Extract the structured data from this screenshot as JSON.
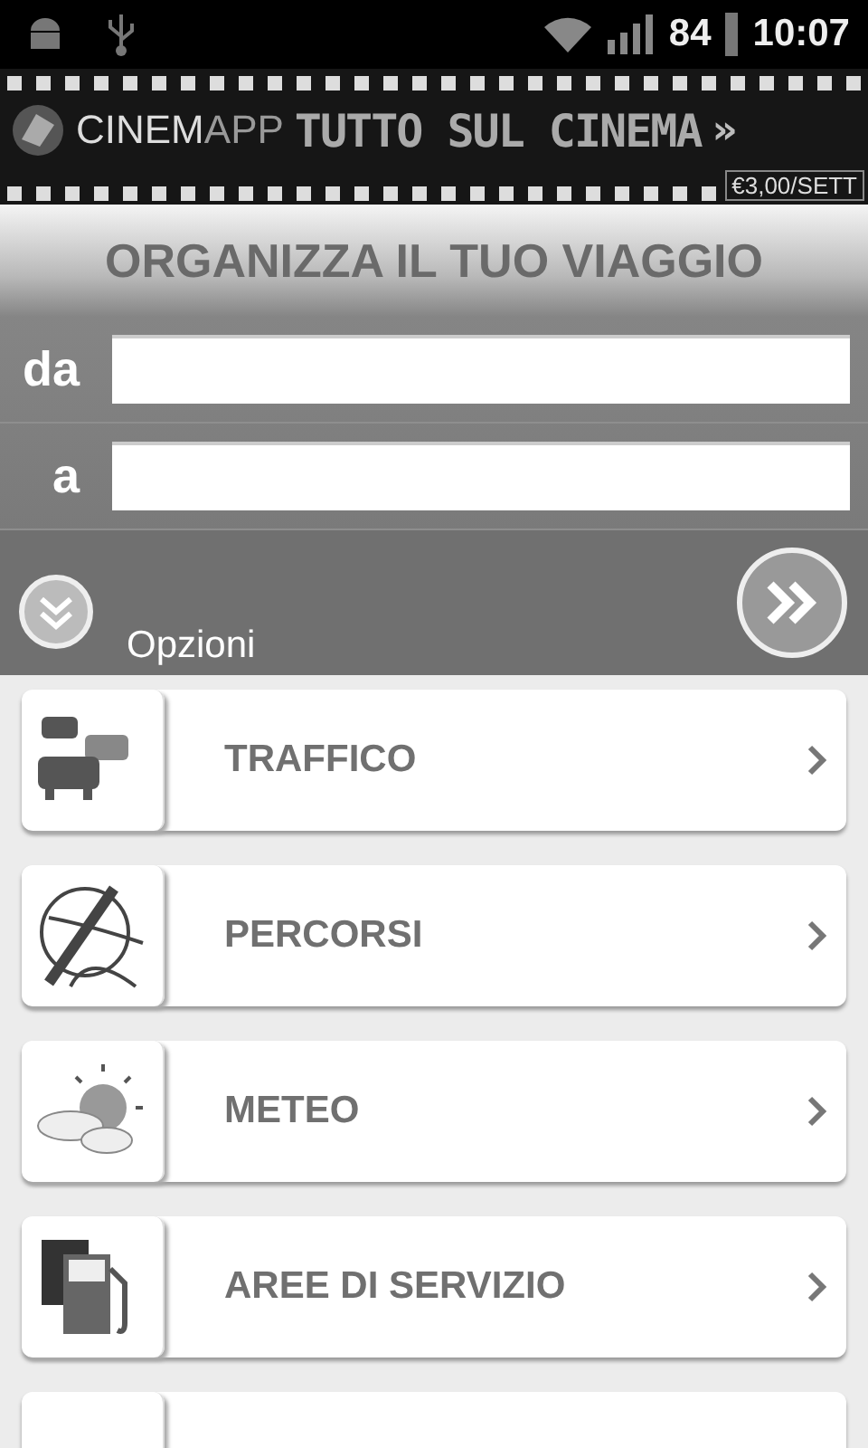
{
  "status_bar": {
    "battery": "84",
    "time": "10:07"
  },
  "banner": {
    "brand_main": "CINEM",
    "brand_accent": "APP",
    "headline": "TUTTO SUL CINEMA",
    "arrow": "»",
    "price": "€3,00/SETT"
  },
  "trip_form": {
    "title": "ORGANIZZA IL TUO VIAGGIO",
    "from_label": "da",
    "to_label": "a",
    "options_label": "Opzioni"
  },
  "menu": [
    {
      "kind": "traffic",
      "label": "TRAFFICO"
    },
    {
      "kind": "routes",
      "label": "PERCORSI"
    },
    {
      "kind": "weather",
      "label": "METEO"
    },
    {
      "kind": "fuel",
      "label": "AREE DI SERVIZIO"
    },
    {
      "kind": "partial"
    }
  ]
}
